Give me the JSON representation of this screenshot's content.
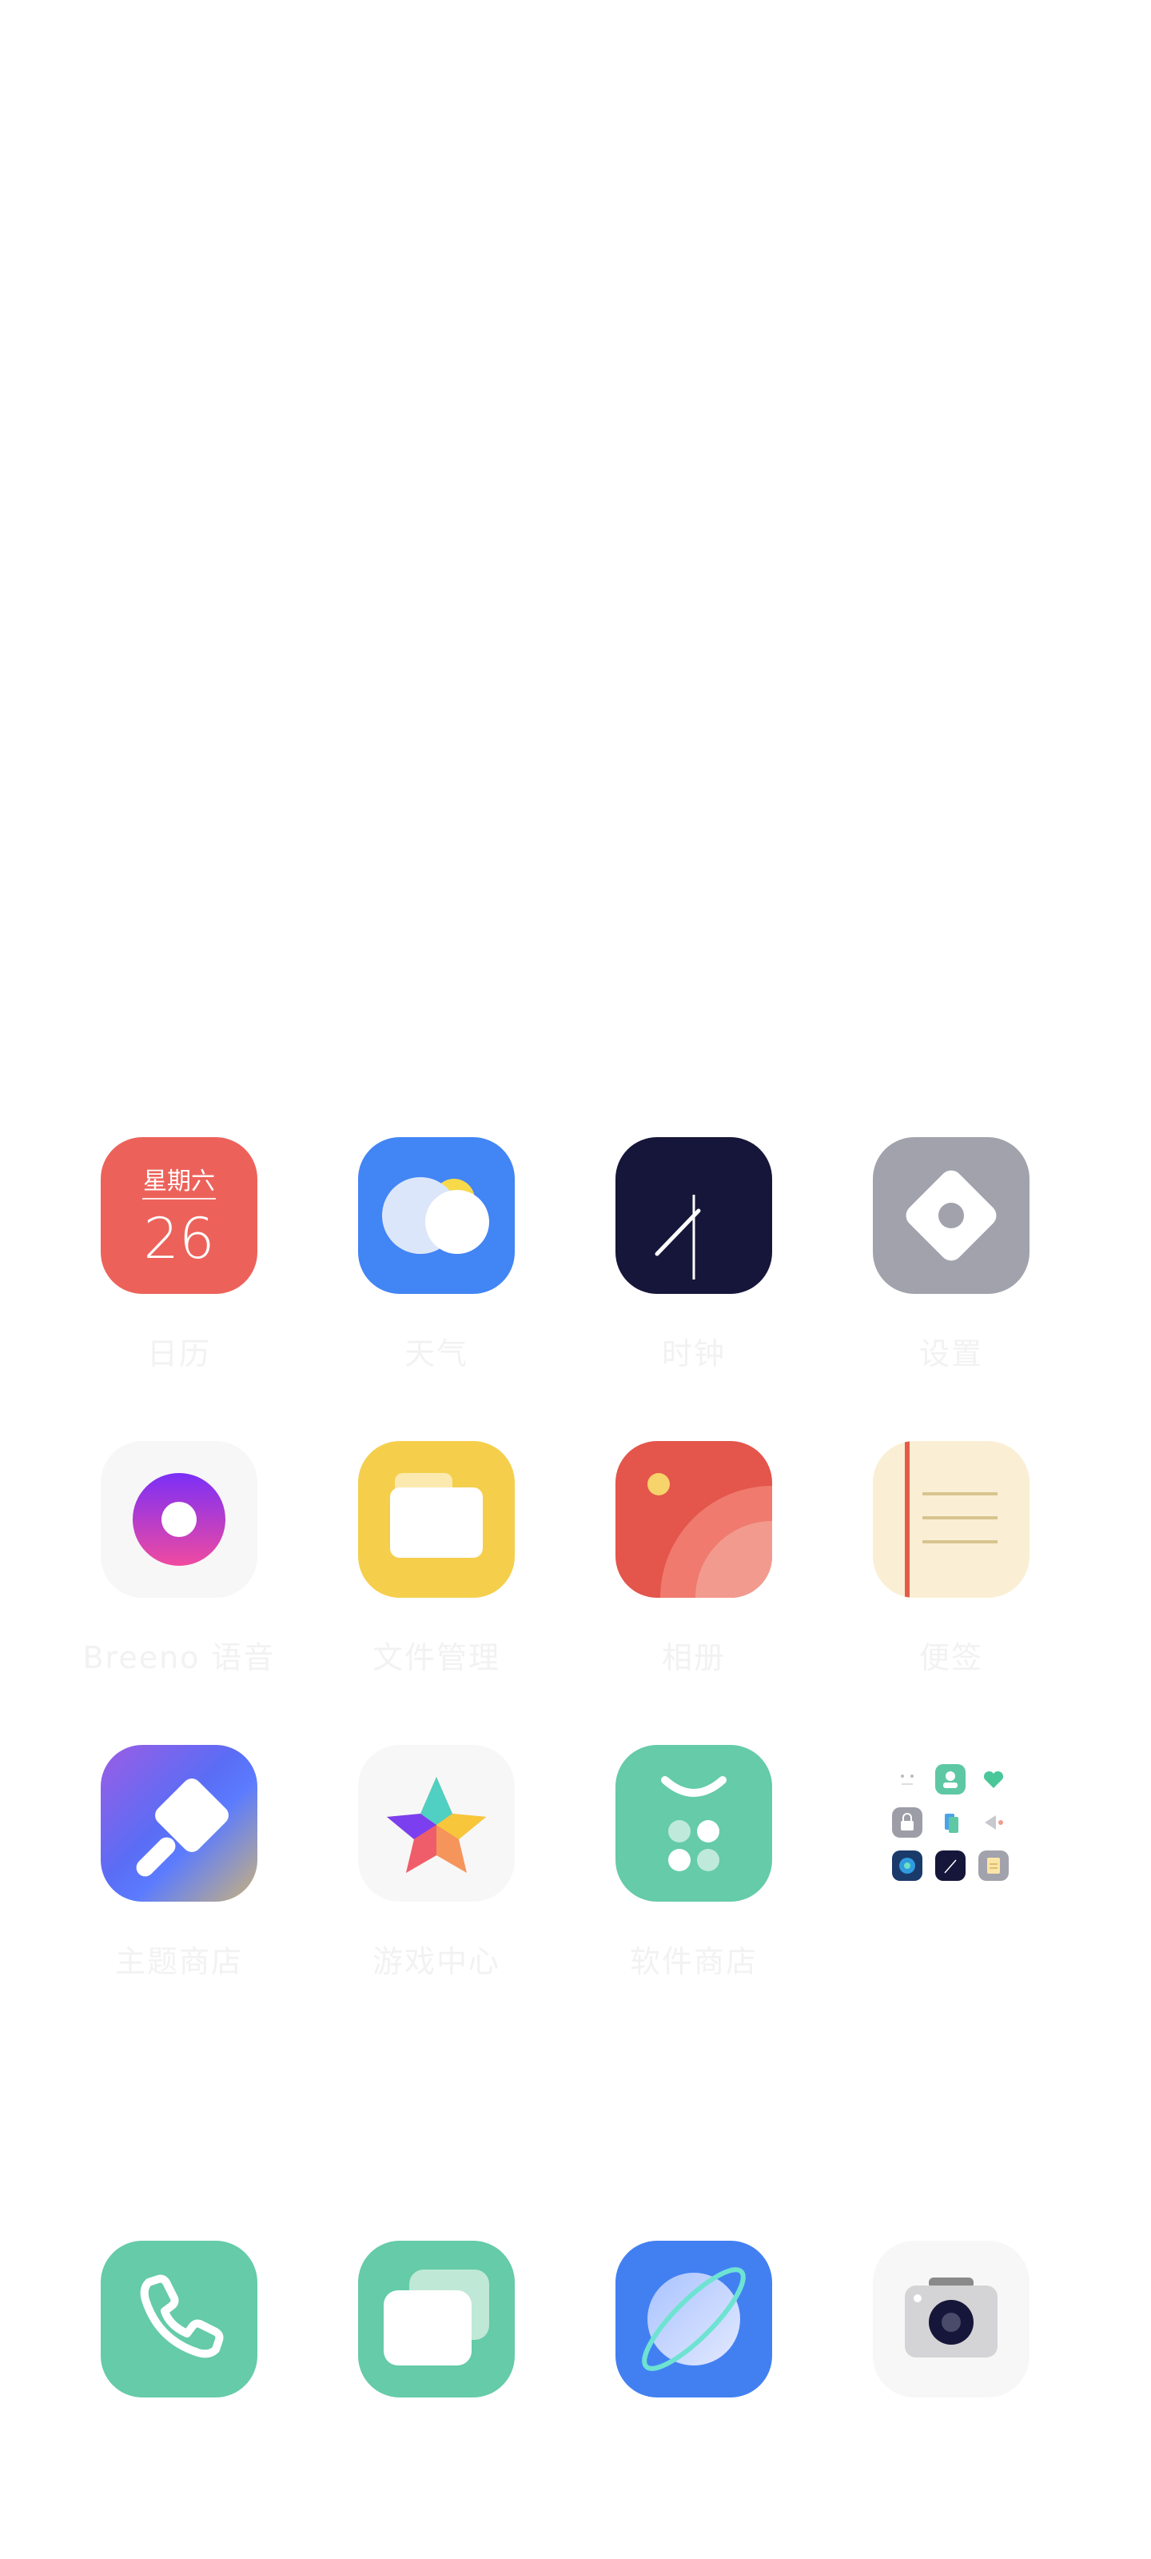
{
  "apps": [
    {
      "name": "日历",
      "weekday": "星期六",
      "day": "26"
    },
    {
      "name": "天气"
    },
    {
      "name": "时钟"
    },
    {
      "name": "设置"
    },
    {
      "name": "Breeno 语音"
    },
    {
      "name": "文件管理"
    },
    {
      "name": "相册"
    },
    {
      "name": "便签"
    },
    {
      "name": "主题商店"
    },
    {
      "name": "游戏中心"
    },
    {
      "name": "软件商店"
    }
  ],
  "dock": [
    {
      "icon": "phone-icon"
    },
    {
      "icon": "messages-icon"
    },
    {
      "icon": "browser-icon"
    },
    {
      "icon": "camera-icon"
    }
  ],
  "colors": {
    "calendar": "#ec625a",
    "weather": "#4285f4",
    "clock": "#16163a",
    "settings": "#a2a2ad",
    "files": "#f5cf4c",
    "photos": "#e4554b",
    "notes": "#faefd4",
    "green": "#65cba8",
    "browser": "#4280f2"
  }
}
